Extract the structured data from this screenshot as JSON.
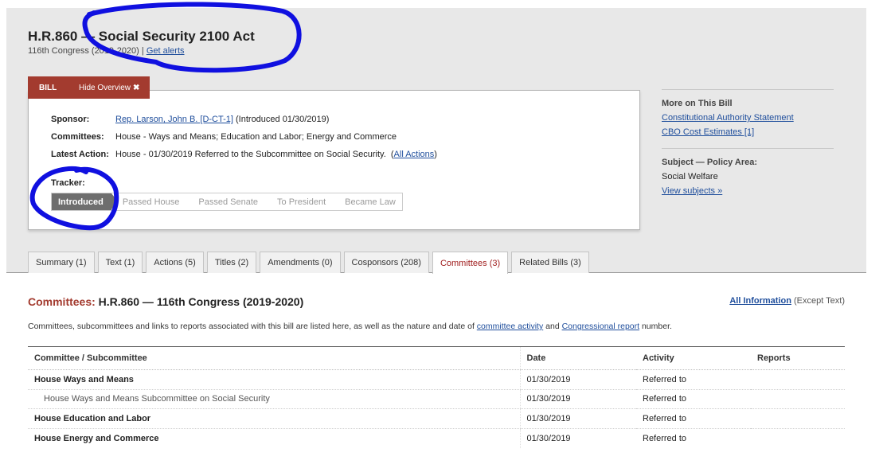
{
  "bill": {
    "title": "H.R.860 — Social Security 2100 Act",
    "congress": "116th Congress (2019-2020)",
    "separator": " | ",
    "get_alerts": "Get alerts"
  },
  "overview_tab": {
    "bill_label": "BILL",
    "hide_label": "Hide Overview"
  },
  "overview": {
    "sponsor_label": "Sponsor:",
    "sponsor_link": "Rep. Larson, John B. [D-CT-1]",
    "sponsor_note": " (Introduced 01/30/2019)",
    "committees_label": "Committees:",
    "committees_value": "House - Ways and Means; Education and Labor; Energy and Commerce",
    "latest_label": "Latest Action:",
    "latest_value": "House - 01/30/2019 Referred to the Subcommittee on Social Security.  (",
    "all_actions": "All Actions",
    "latest_close": ")",
    "tracker_label": "Tracker:",
    "tracker_steps": [
      "Introduced",
      "Passed House",
      "Passed Senate",
      "To President",
      "Became Law"
    ]
  },
  "sidebar": {
    "more_head": "More on This Bill",
    "constitutional": "Constitutional Authority Statement",
    "cbo": "CBO Cost Estimates [1]",
    "subject_head": "Subject — Policy Area:",
    "subject_value": "Social Welfare",
    "view_subjects": "View subjects »"
  },
  "tabs": [
    "Summary (1)",
    "Text (1)",
    "Actions (5)",
    "Titles (2)",
    "Amendments (0)",
    "Cosponsors (208)",
    "Committees (3)",
    "Related Bills (3)"
  ],
  "section": {
    "title_red": "Committees:",
    "title_rest": " H.R.860 — 116th Congress (2019-2020)",
    "all_info": "All Information",
    "except_text": " (Except Text)",
    "desc_1": "Committees, subcommittees and links to reports associated with this bill are listed here, as well as the nature and date of ",
    "desc_link1": "committee activity",
    "desc_2": " and ",
    "desc_link2": "Congressional report",
    "desc_3": " number."
  },
  "table": {
    "headers": [
      "Committee / Subcommittee",
      "Date",
      "Activity",
      "Reports"
    ],
    "rows": [
      {
        "name": "House Ways and Means",
        "date": "01/30/2019",
        "activity": "Referred to",
        "reports": ""
      },
      {
        "name": "House Ways and Means Subcommittee on Social Security",
        "date": "01/30/2019",
        "activity": "Referred to",
        "reports": ""
      },
      {
        "name": "House Education and Labor",
        "date": "01/30/2019",
        "activity": "Referred to",
        "reports": ""
      },
      {
        "name": "House Energy and Commerce",
        "date": "01/30/2019",
        "activity": "Referred to",
        "reports": ""
      }
    ]
  },
  "colors": {
    "accent_red": "#a33b2f",
    "link_blue": "#1f4e9c",
    "annotation_blue": "#1010e0"
  }
}
